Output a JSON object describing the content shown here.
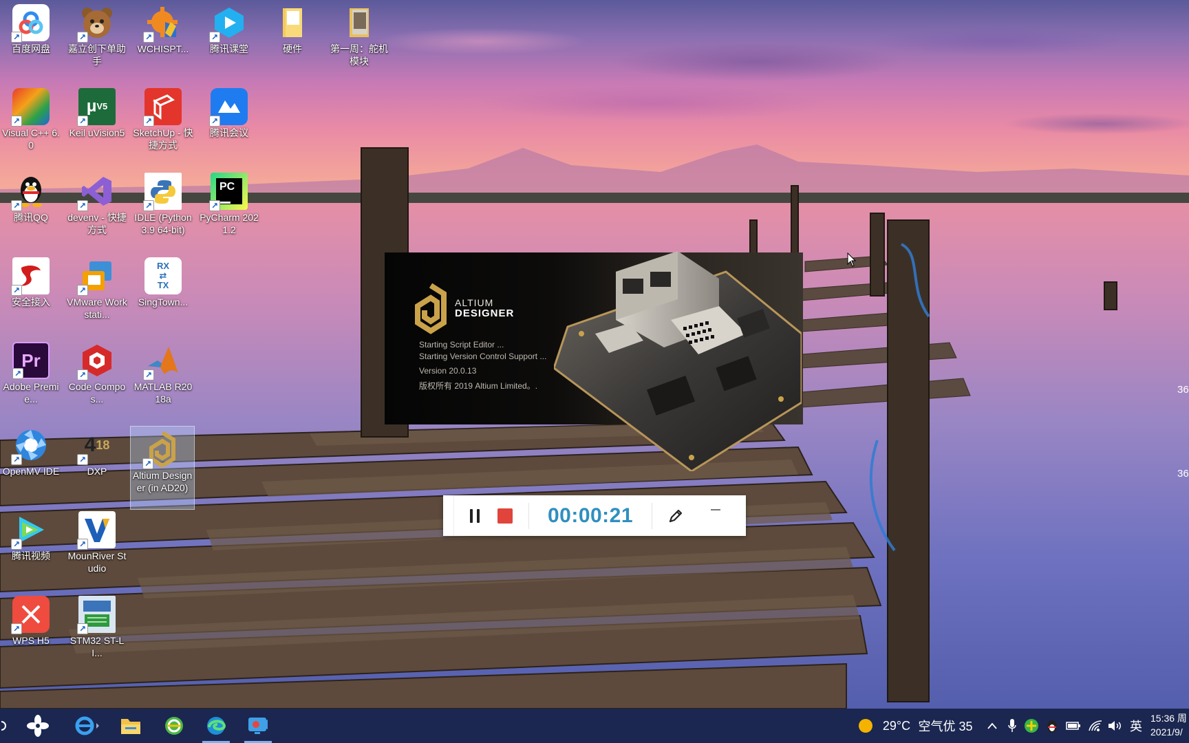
{
  "desktop": {
    "icons": [
      {
        "label": "百度网盘",
        "icon": "baidu-netdisk-icon"
      },
      {
        "label": "嘉立创下单助手",
        "icon": "jlc-order-helper-icon"
      },
      {
        "label": "WCHISPT...",
        "icon": "wchisptool-icon"
      },
      {
        "label": "腾讯课堂",
        "icon": "tencent-classroom-icon"
      },
      {
        "label": "硬件",
        "icon": "folder-icon"
      },
      {
        "label": "第一周：舵机模块",
        "icon": "folder-icon"
      },
      {
        "label": "Visual C++ 6.0",
        "icon": "visual-cpp-icon"
      },
      {
        "label": "Keil uVision5",
        "icon": "keil-uvision-icon"
      },
      {
        "label": "SketchUp - 快捷方式",
        "icon": "sketchup-icon"
      },
      {
        "label": "腾讯会议",
        "icon": "tencent-meeting-icon"
      },
      {
        "label": "腾讯QQ",
        "icon": "qq-penguin-icon"
      },
      {
        "label": "devenv - 快捷方式",
        "icon": "visual-studio-icon"
      },
      {
        "label": "IDLE (Python 3.9 64-bit)",
        "icon": "python-idle-icon"
      },
      {
        "label": "PyCharm 2021.2",
        "icon": "pycharm-icon"
      },
      {
        "label": "安全接入",
        "icon": "secure-access-icon"
      },
      {
        "label": "VMware Workstati...",
        "icon": "vmware-icon"
      },
      {
        "label": "SingTown...",
        "icon": "singtown-rx-tx-icon"
      },
      {
        "label": "Adobe Premie...",
        "icon": "adobe-premiere-icon"
      },
      {
        "label": "Code Compos...",
        "icon": "code-composer-icon"
      },
      {
        "label": "MATLAB R2018a",
        "icon": "matlab-icon"
      },
      {
        "label": "OpenMV IDE",
        "icon": "openmv-icon"
      },
      {
        "label": "DXP",
        "icon": "dxp-icon"
      },
      {
        "label": "Altium Designer (in AD20)",
        "icon": "altium-designer-icon"
      },
      {
        "label": "腾讯视频",
        "icon": "tencent-video-icon"
      },
      {
        "label": "MounRiver Studio",
        "icon": "mounriver-icon"
      },
      {
        "label": "WPS H5",
        "icon": "wps-h5-icon"
      },
      {
        "label": "STM32 ST-LI...",
        "icon": "stlink-utility-icon"
      }
    ],
    "edge_fragments": [
      "36",
      "36"
    ]
  },
  "splash": {
    "brand_top": "ALTIUM",
    "brand_bottom": "DESIGNER",
    "status_lines": [
      "Starting Script Editor ...",
      "Starting Version Control Support ..."
    ],
    "version": "Version 20.0.13",
    "copyright": "版权所有 2019 Altium Limited。."
  },
  "recorder": {
    "timer": "00:00:21",
    "pause_icon": "pause-icon",
    "stop_icon": "stop-icon",
    "pen_icon": "pen-icon",
    "minimize_icon": "minimize-icon",
    "stop_color": "#e1443b",
    "timer_color": "#2f8fbf"
  },
  "taskbar": {
    "apps": [
      {
        "name": "start",
        "icon": "start-icon"
      },
      {
        "name": "internet-explorer",
        "icon": "ie-icon"
      },
      {
        "name": "file-explorer",
        "icon": "folder-icon"
      },
      {
        "name": "browser-360",
        "icon": "browser-360-icon"
      },
      {
        "name": "edge",
        "icon": "edge-icon"
      },
      {
        "name": "screen-recorder",
        "icon": "screen-recorder-icon"
      }
    ],
    "weather": {
      "temp": "29°C",
      "air": "空气优 35"
    },
    "ime": "英",
    "time": "15:36 周",
    "date": "2021/9/"
  }
}
